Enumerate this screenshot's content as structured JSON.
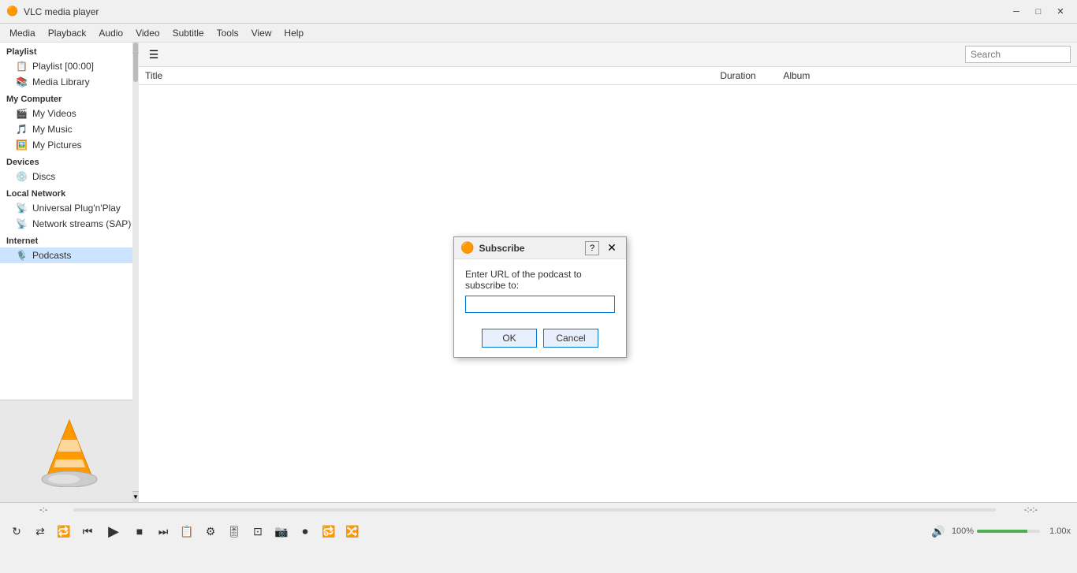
{
  "app": {
    "title": "VLC media player",
    "icon": "🎵"
  },
  "titlebar": {
    "title": "VLC media player",
    "minimize": "─",
    "maximize": "□",
    "close": "✕"
  },
  "menubar": {
    "items": [
      "Media",
      "Playback",
      "Audio",
      "Video",
      "Subtitle",
      "Tools",
      "View",
      "Help"
    ]
  },
  "sidebar": {
    "playlist_section": "Playlist",
    "playlist_item": "Playlist [00:00]",
    "media_library": "Media Library",
    "my_computer": "My Computer",
    "my_videos": "My Videos",
    "my_music": "My Music",
    "my_pictures": "My Pictures",
    "devices": "Devices",
    "discs": "Discs",
    "local_network": "Local Network",
    "universal_plug": "Universal Plug'n'Play",
    "network_streams": "Network streams (SAP)",
    "internet": "Internet",
    "podcasts": "Podcasts"
  },
  "playlist_table": {
    "col_title": "Title",
    "col_duration": "Duration",
    "col_album": "Album"
  },
  "search": {
    "placeholder": "Search"
  },
  "dialog": {
    "title": "Subscribe",
    "help": "?",
    "label": "Enter URL of the podcast to subscribe to:",
    "ok_label": "OK",
    "cancel_label": "Cancel"
  },
  "controls": {
    "time_start": "-:-",
    "time_end": "-:-:-",
    "play": "▶",
    "prev": "⏮",
    "stop": "■",
    "next": "⏭",
    "frame_prev": "⊞",
    "volume": "🔊",
    "volume_pct": "100%",
    "speed": "1.00x"
  }
}
